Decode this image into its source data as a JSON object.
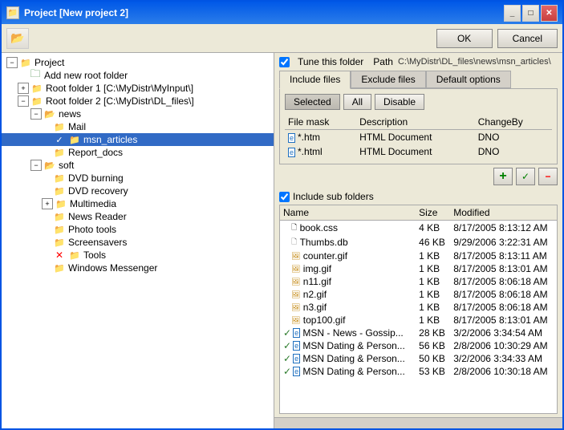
{
  "window": {
    "title": "Project [New project 2]",
    "ok_label": "OK",
    "cancel_label": "Cancel"
  },
  "toolbar": {
    "icon_label": "toolbar-icon"
  },
  "tree": {
    "items": [
      {
        "id": "project",
        "label": "Project",
        "level": 0,
        "type": "folder-open",
        "expanded": true
      },
      {
        "id": "add-root",
        "label": "Add new root folder",
        "level": 1,
        "type": "add"
      },
      {
        "id": "root1",
        "label": "Root folder 1 [C:\\MyDistr\\MyInput\\]",
        "level": 1,
        "type": "folder",
        "expanded": false
      },
      {
        "id": "root2",
        "label": "Root folder 2 [C:\\MyDistr\\DL_files\\]",
        "level": 1,
        "type": "folder",
        "expanded": true
      },
      {
        "id": "news",
        "label": "news",
        "level": 2,
        "type": "folder-open",
        "expanded": true
      },
      {
        "id": "mail",
        "label": "Mail",
        "level": 3,
        "type": "folder"
      },
      {
        "id": "msn_articles",
        "label": "msn_articles",
        "level": 3,
        "type": "folder-check",
        "selected": true
      },
      {
        "id": "report_docs",
        "label": "Report_docs",
        "level": 3,
        "type": "folder"
      },
      {
        "id": "soft",
        "label": "soft",
        "level": 2,
        "type": "folder-open",
        "expanded": true
      },
      {
        "id": "dvd_burning",
        "label": "DVD burning",
        "level": 3,
        "type": "folder"
      },
      {
        "id": "dvd_recovery",
        "label": "DVD recovery",
        "level": 3,
        "type": "folder"
      },
      {
        "id": "multimedia",
        "label": "Multimedia",
        "level": 3,
        "type": "folder",
        "expandable": true
      },
      {
        "id": "news_reader",
        "label": "News Reader",
        "level": 3,
        "type": "folder"
      },
      {
        "id": "photo_tools",
        "label": "Photo tools",
        "level": 3,
        "type": "folder"
      },
      {
        "id": "screensavers",
        "label": "Screensavers",
        "level": 3,
        "type": "folder"
      },
      {
        "id": "tools",
        "label": "Tools",
        "level": 3,
        "type": "folder-x"
      },
      {
        "id": "windows_messenger",
        "label": "Windows Messenger",
        "level": 3,
        "type": "folder"
      }
    ]
  },
  "right_panel": {
    "tune_label": "Tune this folder",
    "path_label": "Path",
    "path_value": "C:\\MyDistr\\DL_files\\news\\msn_articles\\",
    "tabs": [
      {
        "id": "include",
        "label": "Include files",
        "active": true
      },
      {
        "id": "exclude",
        "label": "Exclude files",
        "active": false
      },
      {
        "id": "default",
        "label": "Default options",
        "active": false
      }
    ],
    "filter_buttons": [
      {
        "id": "selected",
        "label": "Selected",
        "active": true
      },
      {
        "id": "all",
        "label": "All",
        "active": false
      },
      {
        "id": "disable",
        "label": "Disable",
        "active": false
      }
    ],
    "table_headers": [
      "File mask",
      "Description",
      "ChangeBy"
    ],
    "table_rows": [
      {
        "mask": "*.htm",
        "description": "HTML Document",
        "change_by": "DNO"
      },
      {
        "mask": "*.html",
        "description": "HTML Document",
        "change_by": "DNO"
      }
    ],
    "include_sub_label": "Include sub folders",
    "add_icon": "+",
    "check_icon": "✓",
    "remove_icon": "−",
    "file_list_headers": [
      "Name",
      "Size",
      "Modified"
    ],
    "file_list_rows": [
      {
        "name": "book.css",
        "size": "4 KB",
        "modified": "8/17/2005 8:13:12 AM",
        "type": "css",
        "checked": false
      },
      {
        "name": "Thumbs.db",
        "size": "46 KB",
        "modified": "9/29/2006 3:22:31 AM",
        "type": "db",
        "checked": false
      },
      {
        "name": "counter.gif",
        "size": "1 KB",
        "modified": "8/17/2005 8:13:11 AM",
        "type": "img",
        "checked": false
      },
      {
        "name": "img.gif",
        "size": "1 KB",
        "modified": "8/17/2005 8:13:01 AM",
        "type": "img",
        "checked": false
      },
      {
        "name": "n11.gif",
        "size": "1 KB",
        "modified": "8/17/2005 8:06:18 AM",
        "type": "img",
        "checked": false
      },
      {
        "name": "n2.gif",
        "size": "1 KB",
        "modified": "8/17/2005 8:06:18 AM",
        "type": "img",
        "checked": false
      },
      {
        "name": "n3.gif",
        "size": "1 KB",
        "modified": "8/17/2005 8:06:18 AM",
        "type": "img",
        "checked": false
      },
      {
        "name": "top100.gif",
        "size": "1 KB",
        "modified": "8/17/2005 8:13:01 AM",
        "type": "img",
        "checked": false
      },
      {
        "name": "MSN - News - Gossip...",
        "size": "28 KB",
        "modified": "3/2/2006 3:34:54 AM",
        "type": "htm",
        "checked": true
      },
      {
        "name": "MSN Dating & Person...",
        "size": "56 KB",
        "modified": "2/8/2006 10:30:29 AM",
        "type": "htm",
        "checked": true
      },
      {
        "name": "MSN Dating & Person...",
        "size": "50 KB",
        "modified": "3/2/2006 3:34:33 AM",
        "type": "htm",
        "checked": true
      },
      {
        "name": "MSN Dating & Person...",
        "size": "53 KB",
        "modified": "2/8/2006 10:30:18 AM",
        "type": "htm",
        "checked": true
      }
    ]
  }
}
